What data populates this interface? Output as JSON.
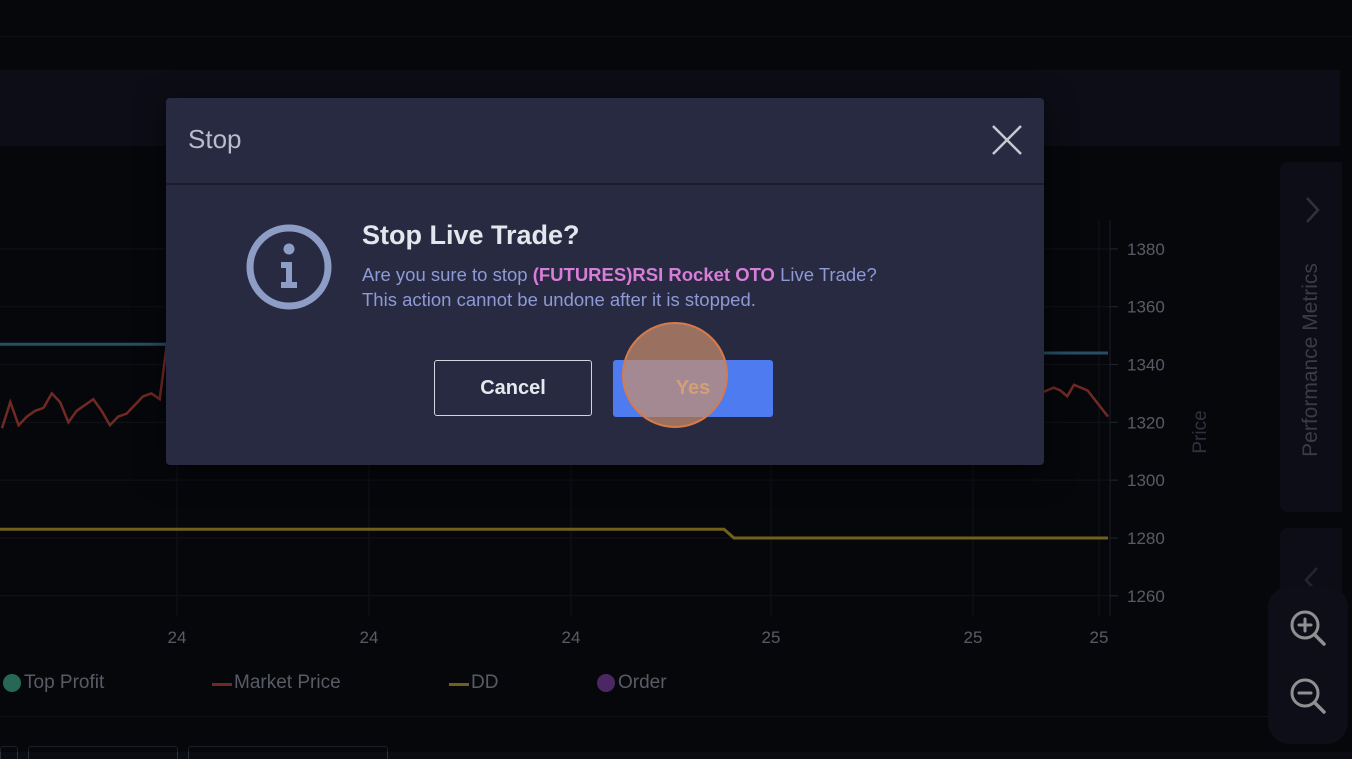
{
  "chart_data": {
    "type": "line",
    "x_tick_labels": [
      "24",
      "24",
      "24",
      "25",
      "25",
      "25"
    ],
    "y_ticks": [
      1260,
      1280,
      1300,
      1320,
      1340,
      1360,
      1380
    ],
    "ylim": [
      1253,
      1390
    ],
    "ylabel": "Price",
    "grid": true,
    "series": [
      {
        "name": "Top Profit",
        "color": "#3fa68a",
        "marker": "circle"
      },
      {
        "name": "Market Price",
        "color": "#b8433b",
        "marker": "line",
        "visible_values": [
          1318,
          1327,
          1319,
          1322,
          1324,
          1325,
          1330,
          1327,
          1320,
          1324,
          1326,
          1328,
          1324,
          1319,
          1322,
          1323,
          1326,
          1329,
          1330,
          1328,
          1350
        ],
        "right_values": [
          1330,
          1331,
          1332,
          1331,
          1329,
          1333,
          1332,
          1331,
          1328,
          1325,
          1322
        ]
      },
      {
        "name": "DD",
        "color": "#b79a2e",
        "marker": "line",
        "values": [
          1283,
          1283,
          1283,
          1283,
          1280,
          1280,
          1280
        ]
      },
      {
        "name": "Order",
        "color": "#7a3fa0",
        "marker": "circle"
      },
      {
        "name": "",
        "color": "#3f7fa3",
        "values": [
          1347,
          1347,
          1344,
          1344
        ]
      }
    ]
  },
  "legend": {
    "top_profit": "Top Profit",
    "market_price": "Market Price",
    "dd": "DD",
    "order": "Order"
  },
  "side_panel": {
    "label": "Performance Metrics"
  },
  "modal": {
    "title": "Stop",
    "heading": "Stop Live Trade?",
    "message_prefix": "Are you sure to stop ",
    "strategy_name": "(FUTURES)RSI Rocket OTO",
    "message_suffix": " Live Trade?",
    "message_line2": "This action cannot be undone after it is stopped.",
    "cancel_label": "Cancel",
    "yes_label": "Yes"
  },
  "colors": {
    "background": "#0b0c12",
    "modal": "#282a41",
    "accent_button": "#4e7cf0",
    "highlight_text": "#d67ed8",
    "info_icon": "#8e9dc6"
  }
}
